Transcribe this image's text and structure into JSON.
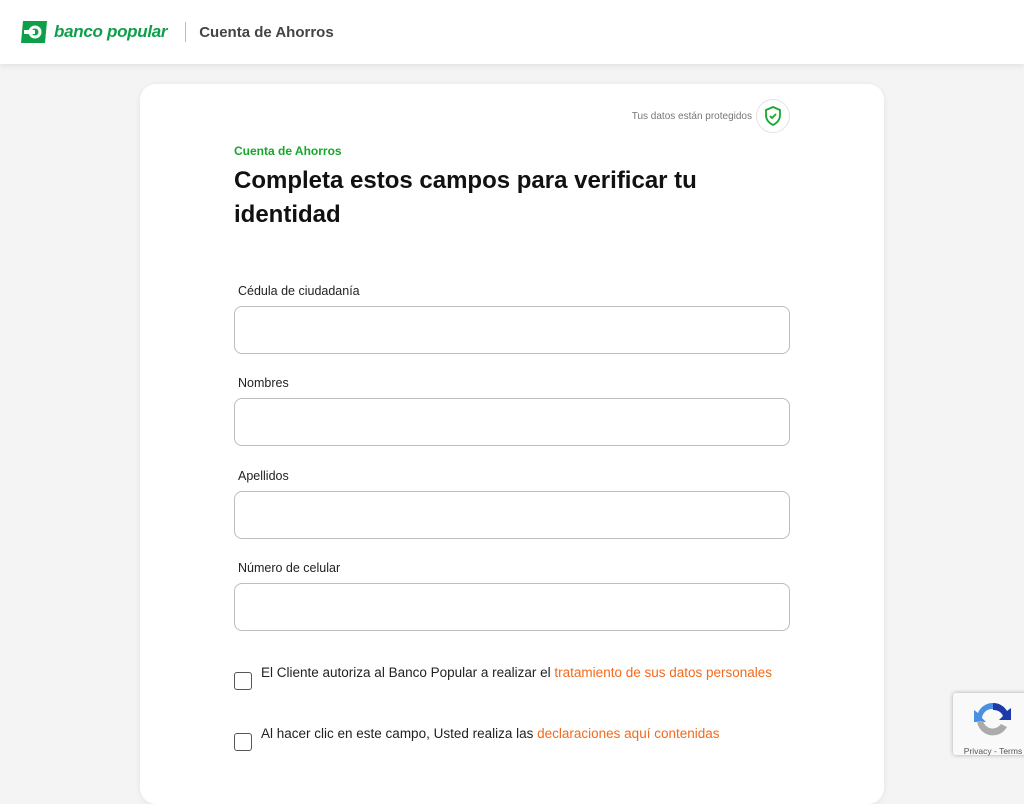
{
  "header": {
    "brand": "banco popular",
    "title": "Cuenta de Ahorros"
  },
  "badge": {
    "text": "Tus datos están protegidos",
    "icon": "shield-check-icon"
  },
  "form": {
    "eyebrow": "Cuenta de Ahorros",
    "title": "Completa estos campos para verificar tu identidad",
    "fields": [
      {
        "label": "Cédula de ciudadanía",
        "value": ""
      },
      {
        "label": "Nombres",
        "value": ""
      },
      {
        "label": "Apellidos",
        "value": ""
      },
      {
        "label": "Número de celular",
        "value": ""
      }
    ],
    "consent1": {
      "text": "El Cliente autoriza al Banco Popular a realizar el ",
      "link": "tratamiento de sus datos personales",
      "checked": false
    },
    "consent2": {
      "text": "Al hacer clic en este campo, Usted realiza las ",
      "link": "declaraciones aquí contenidas",
      "checked": false
    }
  },
  "recaptcha": {
    "text": "Privacy - Terms"
  },
  "colors": {
    "brand": "#0e9f49",
    "link": "#f26a1b"
  }
}
